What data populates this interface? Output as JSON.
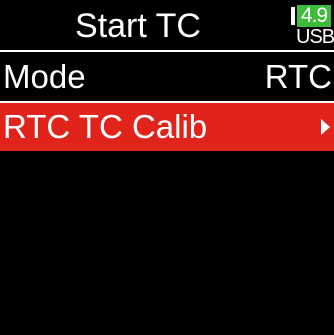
{
  "header": {
    "title": "Start TC",
    "battery": {
      "level": "4.9",
      "source": "USB",
      "level_color": "#3dbb3a"
    }
  },
  "menu": {
    "items": [
      {
        "label": "Mode",
        "value": "RTC",
        "selected": false
      },
      {
        "label": "RTC TC Calib",
        "value": "",
        "selected": true,
        "has_submenu": true,
        "highlight_color": "#e0241c"
      }
    ]
  }
}
